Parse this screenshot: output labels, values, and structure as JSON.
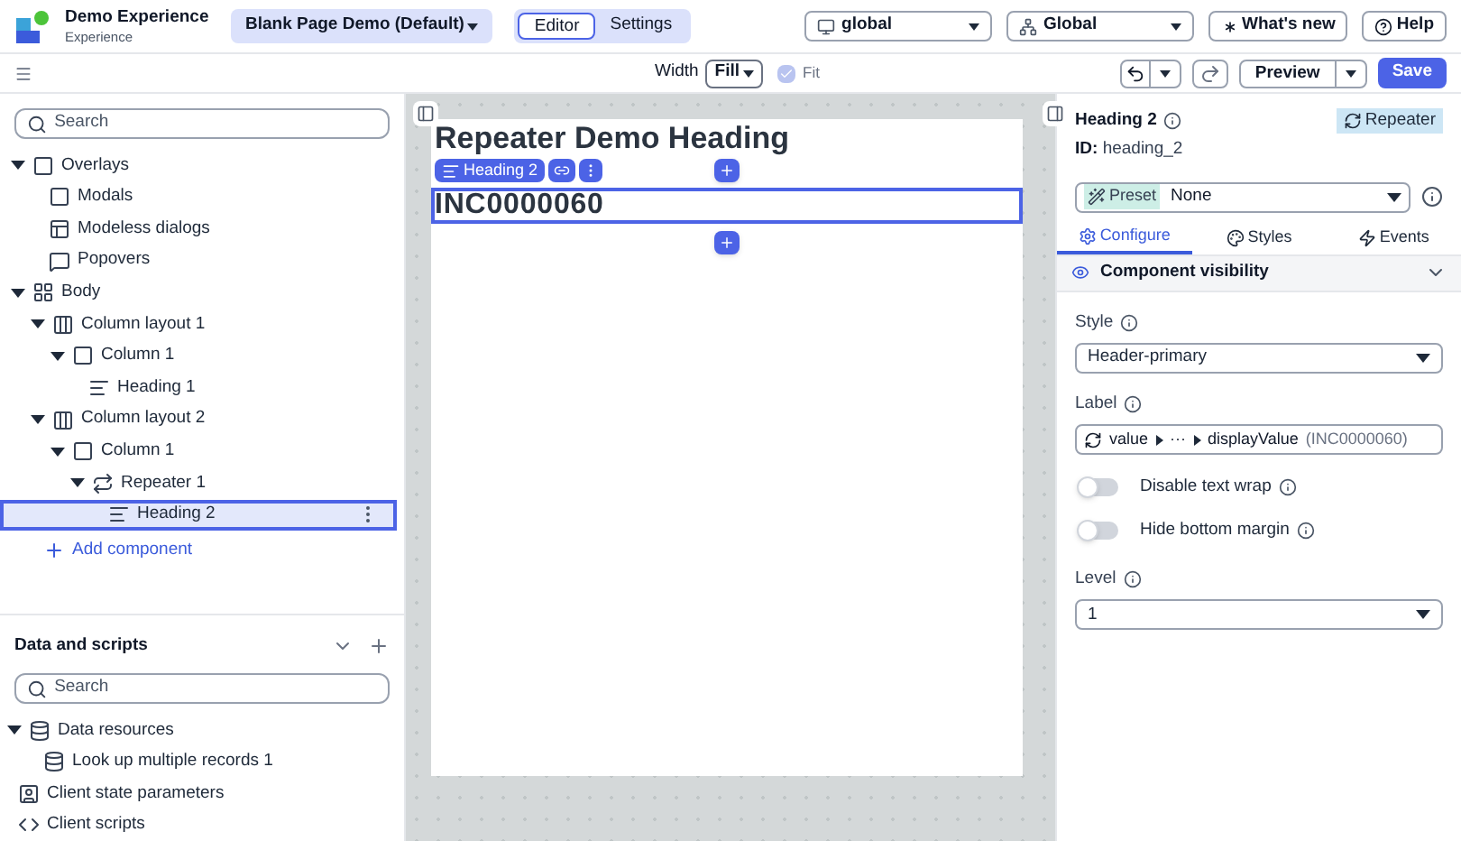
{
  "app": {
    "name": "Demo Experience",
    "subtitle": "Experience"
  },
  "page_selector": "Blank Page Demo (Default)",
  "mode_tabs": [
    {
      "label": "Editor",
      "selected": true
    },
    {
      "label": "Settings",
      "selected": false
    }
  ],
  "scope_select": "global",
  "app_select": "Global",
  "header_buttons": [
    {
      "kind": "whatsnew",
      "label": "What's new"
    },
    {
      "kind": "help",
      "label": "Help"
    }
  ],
  "toolbar": {
    "width_label": "Width",
    "width_value": "Fill",
    "fit": {
      "label": "Fit",
      "checked": true,
      "disabled": true
    },
    "preview": "Preview",
    "save": "Save"
  },
  "tree": {
    "search_placeholder": "Search",
    "add_component": "Add component",
    "items": [
      {
        "label": "Overlays",
        "kind": "overlay",
        "expanded": true,
        "selected": false,
        "children": [
          {
            "label": "Modals",
            "kind": "overlay",
            "selected": false
          },
          {
            "label": "Modeless dialogs",
            "kind": "modeless",
            "selected": false
          },
          {
            "label": "Popovers",
            "kind": "popover",
            "selected": false
          }
        ]
      },
      {
        "label": "Body",
        "kind": "body",
        "expanded": true,
        "selected": false,
        "children": [
          {
            "label": "Column layout 1",
            "kind": "columns",
            "expanded": true,
            "selected": false,
            "children": [
              {
                "label": "Column 1",
                "kind": "column",
                "expanded": true,
                "selected": false,
                "children": [
                  {
                    "label": "Heading 1",
                    "kind": "heading",
                    "selected": false
                  }
                ]
              }
            ]
          },
          {
            "label": "Column layout 2",
            "kind": "columns",
            "expanded": true,
            "selected": false,
            "children": [
              {
                "label": "Column 1",
                "kind": "column",
                "expanded": true,
                "selected": false,
                "children": [
                  {
                    "label": "Repeater 1",
                    "kind": "repeater",
                    "expanded": true,
                    "selected": false,
                    "children": [
                      {
                        "label": "Heading 2",
                        "kind": "heading",
                        "selected": true
                      }
                    ]
                  }
                ]
              }
            ]
          }
        ]
      }
    ]
  },
  "data_scripts": {
    "title": "Data and scripts",
    "search_placeholder": "Search",
    "items": [
      {
        "label": "Data resources",
        "kind": "database",
        "expanded": true,
        "children": [
          {
            "label": "Look up multiple records 1",
            "kind": "database"
          }
        ]
      },
      {
        "label": "Client state parameters",
        "kind": "params"
      },
      {
        "label": "Client scripts",
        "kind": "code"
      }
    ]
  },
  "canvas": {
    "title": "Repeater Demo Heading",
    "chip": "Heading 2",
    "value": "INC0000060"
  },
  "props": {
    "title": "Heading 2",
    "id_label": "ID:",
    "id": "heading_2",
    "badge": "Repeater",
    "preset_label": "Preset",
    "preset_value": "None",
    "tabs": [
      {
        "label": "Configure",
        "kind": "configure",
        "selected": true
      },
      {
        "label": "Styles",
        "kind": "styles",
        "selected": false
      },
      {
        "label": "Events",
        "kind": "events",
        "selected": false
      }
    ],
    "section": "Component visibility",
    "style": {
      "label": "Style",
      "value": "Header-primary"
    },
    "label": {
      "label": "Label",
      "path": [
        "value",
        "···",
        "displayValue"
      ],
      "preview": "(INC0000060)"
    },
    "toggles": [
      {
        "label": "Disable text wrap",
        "on": false
      },
      {
        "label": "Hide bottom margin",
        "on": false
      }
    ],
    "level": {
      "label": "Level",
      "value": "1"
    }
  }
}
